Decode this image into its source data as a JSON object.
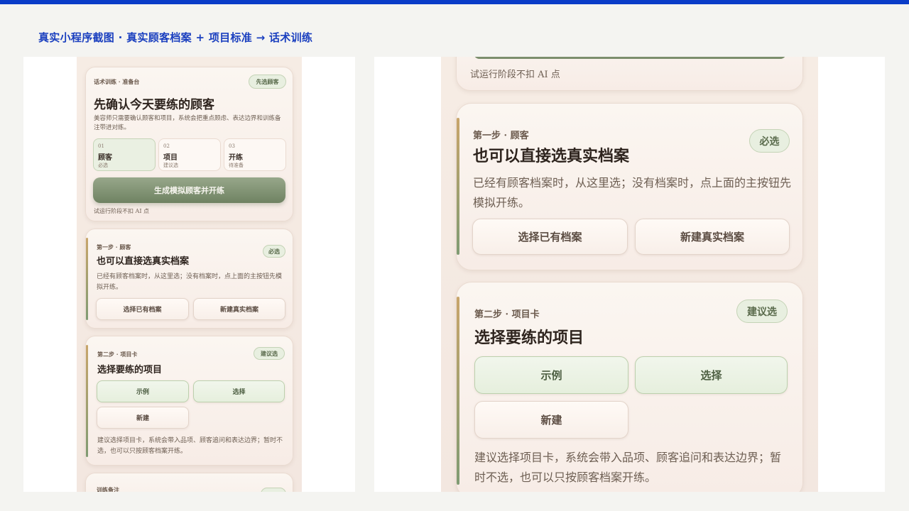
{
  "page_heading": "真实小程序截图 · 真实顾客档案 + 项目标准 → 话术训练",
  "colors": {
    "brand_blue": "#0a3cc8",
    "sage_green": "#7f9b73",
    "gold_accent": "#c8a56b"
  },
  "left": {
    "hero": {
      "eyebrow": "话术训练 · 准备台",
      "pill": "先选顾客",
      "title": "先确认今天要练的顾客",
      "desc": "美容师只需要确认顾客和项目，系统会把重点顾虑、表达边界和训练备注带进对练。",
      "steps": [
        {
          "num": "01",
          "label": "顾客",
          "sub": "必选"
        },
        {
          "num": "02",
          "label": "项目",
          "sub": "建议选"
        },
        {
          "num": "03",
          "label": "开练",
          "sub": "待准备"
        }
      ],
      "primary": "生成模拟顾客并开练",
      "note": "试运行阶段不扣 AI 点"
    },
    "card1": {
      "eyebrow": "第一步 · 顾客",
      "pill": "必选",
      "title": "也可以直接选真实档案",
      "desc": "已经有顾客档案时，从这里选；没有档案时，点上面的主按钮先模拟开练。",
      "btn_a": "选择已有档案",
      "btn_b": "新建真实档案"
    },
    "card2": {
      "eyebrow": "第二步 · 项目卡",
      "pill": "建议选",
      "title": "选择要练的项目",
      "btn_example": "示例",
      "btn_select": "选择",
      "btn_new": "新建",
      "desc": "建议选择项目卡，系统会带入品项、顾客追问和表达边界；暂时不选，也可以只按顾客档案开练。"
    },
    "card3": {
      "eyebrow": "训练备注"
    }
  },
  "right": {
    "top_note": "试运行阶段不扣 AI 点",
    "card1": {
      "eyebrow": "第一步 · 顾客",
      "pill": "必选",
      "title": "也可以直接选真实档案",
      "desc": "已经有顾客档案时，从这里选；没有档案时，点上面的主按钮先模拟开练。",
      "btn_a": "选择已有档案",
      "btn_b": "新建真实档案"
    },
    "card2": {
      "eyebrow": "第二步 · 项目卡",
      "pill": "建议选",
      "title": "选择要练的项目",
      "btn_example": "示例",
      "btn_select": "选择",
      "btn_new": "新建",
      "desc": "建议选择项目卡，系统会带入品项、顾客追问和表达边界；暂时不选，也可以只按顾客档案开练。"
    }
  }
}
